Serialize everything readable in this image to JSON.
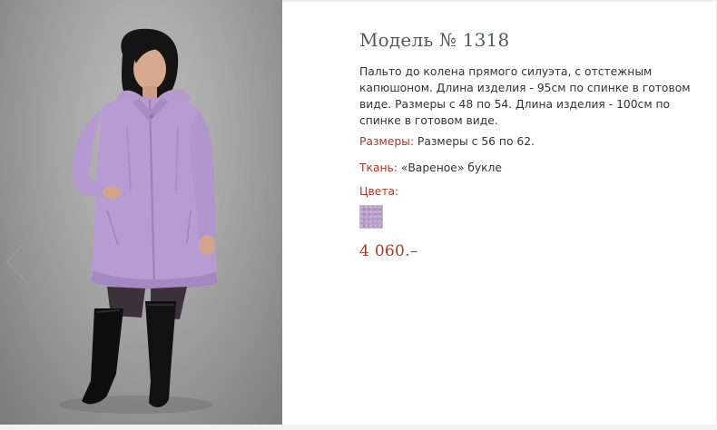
{
  "product": {
    "title": "Модель № 1318",
    "description": "Пальто до колена прямого силуэта, с отстежным капюшоном. Длина изделия - 95см по спинке в готовом виде. Размеры с 48 по 54. Длина изделия - 100см по спинке в готовом виде.",
    "sizes_label": "Размеры:",
    "sizes_value": "Размеры с 56 по 62.",
    "fabric_label": "Ткань:",
    "fabric_value": "«Вареное» букле",
    "colors_label": "Цвета:",
    "price": "4 060.–"
  },
  "colors": {
    "accent": "#b0361e",
    "title": "#555a60",
    "swatch": "#b69fc6",
    "coat": "#b79cd3"
  },
  "icons": {
    "prev": "chevron-left-icon"
  }
}
